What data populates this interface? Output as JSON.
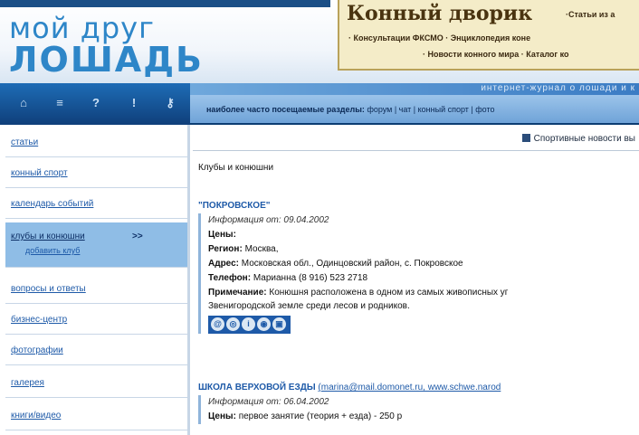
{
  "header": {
    "logo_line1": "мой друг",
    "logo_line2": "ЛОШАДЬ",
    "promo_title": "Конный дворик",
    "promo_line1": "·Статьи из а",
    "promo_line2": "· Консультации ФКСМО · Энциклопедия коне",
    "promo_line3": "· Новости конного мира · Каталог ко",
    "subtitle": "интернет-журнал о лошади и к"
  },
  "iconbar": {
    "icons": [
      "home-icon",
      "menu-icon",
      "help-icon",
      "info-icon",
      "key-icon"
    ]
  },
  "navstrip": {
    "label": "наиболее часто посещаемые разделы:",
    "links": "форум | чат | конный спорт | фото"
  },
  "sidebar": {
    "items": [
      {
        "label": "статьи"
      },
      {
        "label": "конный спорт"
      },
      {
        "label": "календарь событий"
      },
      {
        "label": "клубы и конюшни",
        "arrow": ">>",
        "sub": "добавить клуб"
      },
      {
        "label": "вопросы и ответы"
      },
      {
        "label": "бизнес-центр"
      },
      {
        "label": "фотографии"
      },
      {
        "label": "галерея"
      },
      {
        "label": "книги/видео"
      }
    ]
  },
  "main": {
    "news_link": "Спортивные новости вы",
    "section_title": "Клубы и конюшни",
    "entries": [
      {
        "title": "\"ПОКРОВСКОЕ\"",
        "info": "Информация от: 09.04.2002",
        "price_label": "Цены:",
        "price": "",
        "region_label": "Регион:",
        "region": "Москва,",
        "address_label": "Адрес:",
        "address": "Московская обл., Одинцовский район, с. Покровское",
        "phone_label": "Телефон:",
        "phone": "Марианна (8 916) 523 2718",
        "note_label": "Примечание:",
        "note": "Конюшня расположена в одном из самых живописных уг",
        "note_cont": "Звенигородской земле среди лесов и родников."
      },
      {
        "title": "ШКОЛА ВЕРХОВОЙ ЕЗДЫ",
        "extra": "(marina@mail.domonet.ru, www.schwe.narod",
        "info": "Информация от: 06.04.2002",
        "price_label": "Цены:",
        "price": "первое занятие (теория + езда) - 250 р"
      }
    ]
  }
}
